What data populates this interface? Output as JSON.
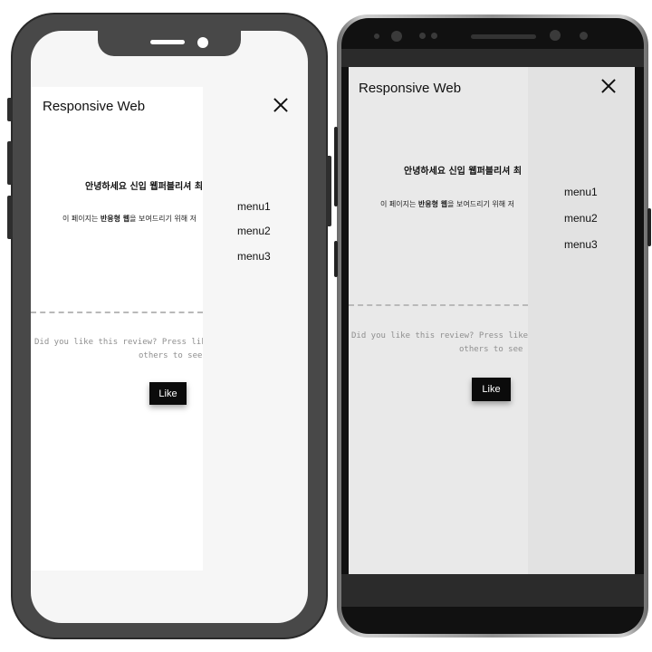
{
  "site": {
    "title": "Responsive Web",
    "greeting": "안녕하세요 신입 웹퍼블리셔 최",
    "intro_before": "이 페이지는 ",
    "intro_bold": "반응형 웹",
    "intro_after": "을 보여드리기 위해 저"
  },
  "review": {
    "line1": "Did you like this review? Press like",
    "line2": "others to see"
  },
  "like_label": "Like",
  "menu": [
    {
      "label": "menu1"
    },
    {
      "label": "menu2"
    },
    {
      "label": "menu3"
    }
  ],
  "icons": {
    "close": "close-icon"
  }
}
